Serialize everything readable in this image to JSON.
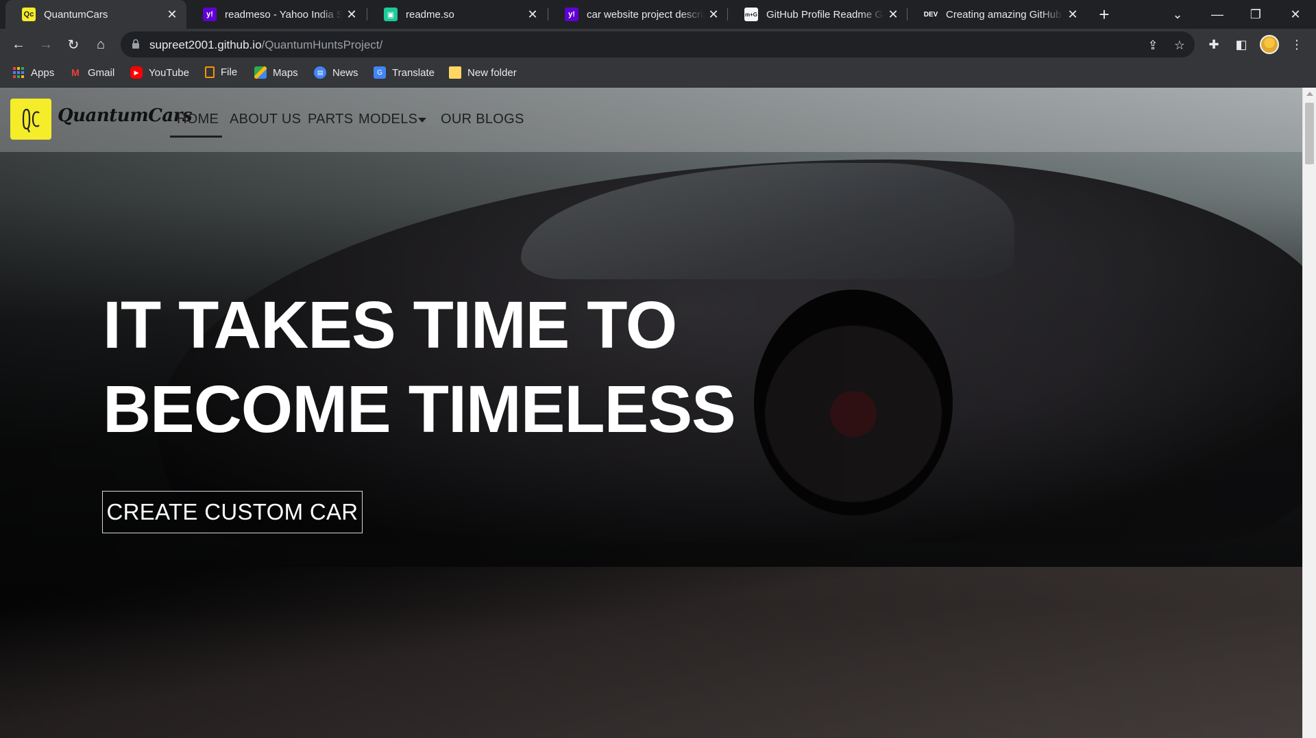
{
  "browser": {
    "tabs": [
      {
        "title": "QuantumCars",
        "favicon": "quantumcars-favicon",
        "active": true
      },
      {
        "title": "readmeso - Yahoo India Search",
        "favicon": "yahoo-favicon",
        "active": false
      },
      {
        "title": "readme.so",
        "favicon": "readme-so-favicon",
        "active": false
      },
      {
        "title": "car website project description",
        "favicon": "yahoo-favicon",
        "active": false
      },
      {
        "title": "GitHub Profile Readme Generator",
        "favicon": "readme-generator-favicon",
        "active": false
      },
      {
        "title": "Creating amazing GitHub profile",
        "favicon": "dev-favicon",
        "active": false
      }
    ],
    "favicon_text": {
      "dev": "DEV",
      "generator": "m+G",
      "yahoo": "y!",
      "qc": "Qc"
    },
    "url": {
      "host": "supreet2001.github.io",
      "path": "/QuantumHuntsProject/"
    },
    "bookmarks": [
      {
        "label": "Apps",
        "icon": "apps-grid-icon"
      },
      {
        "label": "Gmail",
        "icon": "gmail-icon"
      },
      {
        "label": "YouTube",
        "icon": "youtube-icon"
      },
      {
        "label": "File",
        "icon": "file-icon"
      },
      {
        "label": "Maps",
        "icon": "maps-icon"
      },
      {
        "label": "News",
        "icon": "news-icon"
      },
      {
        "label": "Translate",
        "icon": "translate-icon"
      },
      {
        "label": "New folder",
        "icon": "folder-icon"
      }
    ],
    "colors": {
      "tabstrip": "#202124",
      "toolbar": "#35363a",
      "text": "#e8eaed"
    }
  },
  "site": {
    "logo_mark": "Qc",
    "brand": "QuantumCars",
    "nav": [
      "HOME",
      "ABOUT US",
      "PARTS",
      "MODELS",
      "OUR BLOGS"
    ],
    "active_nav": "HOME",
    "headline": [
      "IT TAKES TIME TO",
      "BECOME TIMELESS"
    ],
    "cta": "CREATE CUSTOM CAR",
    "colors": {
      "logo_bg": "#f5ec2a",
      "headline": "#ffffff"
    }
  }
}
